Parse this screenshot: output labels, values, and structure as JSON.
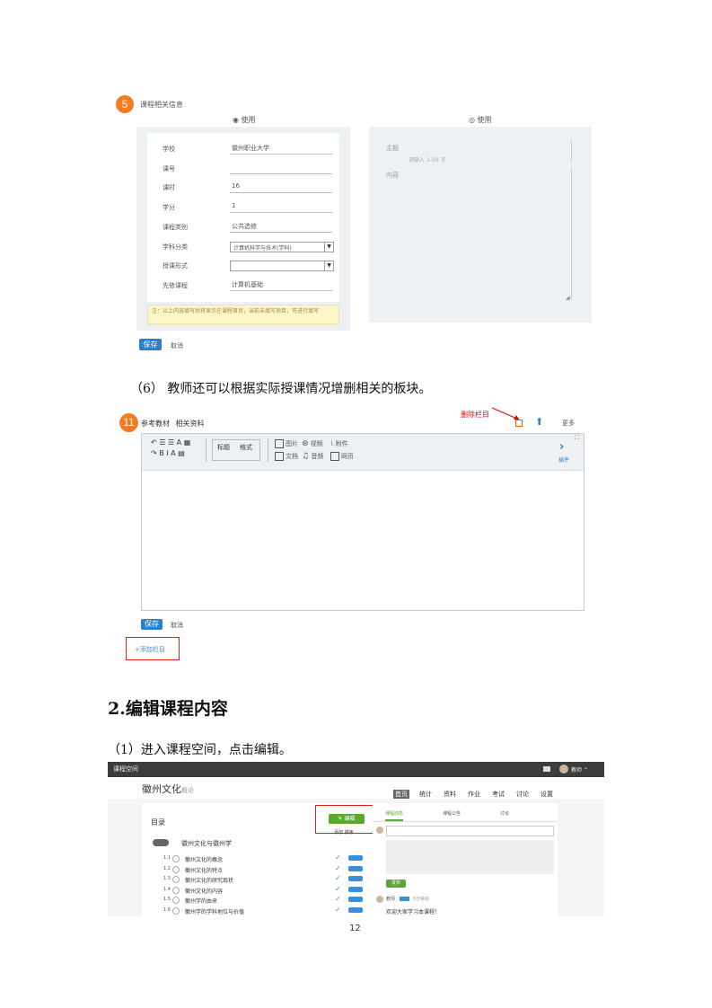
{
  "section1": {
    "badge": "5",
    "header": "课程相关信息",
    "left_tab": "使用",
    "right_tab": "使用",
    "fields": [
      {
        "label": "学校",
        "value": "徽州职业大学"
      },
      {
        "label": "课号",
        "value": ""
      },
      {
        "label": "课时",
        "value": "16"
      },
      {
        "label": "学分",
        "value": "1"
      },
      {
        "label": "课程类别",
        "value": "公共选修"
      },
      {
        "label": "学科分类",
        "value": "计算机科学与技术(学科)"
      },
      {
        "label": "授课形式",
        "value": ""
      },
      {
        "label": "先修课程",
        "value": "计算机基础"
      }
    ],
    "notice": "注：以上内容填写后将显示在课程首页，当前未填写项目，可进行填写",
    "right_title_label": "主题",
    "right_title_placeholder": "请输入 1-50 字",
    "right_content_label": "内容",
    "save": "保存",
    "cancel": "取消"
  },
  "paragraph6": "（6） 教师还可以根据实际授课情况增删相关的板块。",
  "section2": {
    "badge": "11",
    "header": "参考教材",
    "header_sub": "相关资料",
    "annotation": "删除栏目",
    "right_link": "更多",
    "toolbar_left_row1": "↶ ☰ ☰ A ▦",
    "toolbar_left_row2": "↷ B I A ▤",
    "toolbar_mid_1": "标题",
    "toolbar_mid_2": "格式",
    "toolbar_right_1": "图片",
    "toolbar_right_2": "视频",
    "toolbar_right_3": "附件",
    "toolbar_right_4": "文档",
    "toolbar_right_5": "音频",
    "toolbar_right_6": "网页",
    "toolbar_more": "插件",
    "save": "保存",
    "cancel": "取消",
    "add_column": "+添加栏目"
  },
  "heading2": "2.编辑课程内容",
  "paragraph1": "（1）进入课程空间，点击编辑。",
  "section3": {
    "topbar_title": "课程空间",
    "user_name": "教师",
    "course_title": "徽州文化",
    "course_sub": "概论",
    "nav": [
      "首页",
      "统计",
      "资料",
      "作业",
      "考试",
      "讨论",
      "设置"
    ],
    "left_title": "目录",
    "edit_button": "编辑",
    "edit_sub": "添加 排序",
    "chapter": "徽州文化与徽州学",
    "items": [
      {
        "num": "1.1",
        "text": "徽州文化的概念"
      },
      {
        "num": "1.2",
        "text": "徽州文化的特点"
      },
      {
        "num": "1.3",
        "text": "徽州文化的研究现状"
      },
      {
        "num": "1.4",
        "text": "徽州文化的内容"
      },
      {
        "num": "1.5",
        "text": "徽州学的由来"
      },
      {
        "num": "1.6",
        "text": "徽州学的学科地位与价值"
      }
    ],
    "right_tabs": [
      "课程动态",
      "课程公告",
      "讨论"
    ],
    "post_button": "发布",
    "comment_name": "教师",
    "comment_time": "5分钟前",
    "comment_text": "欢迎大家学习本课程！"
  },
  "page_number": "12"
}
